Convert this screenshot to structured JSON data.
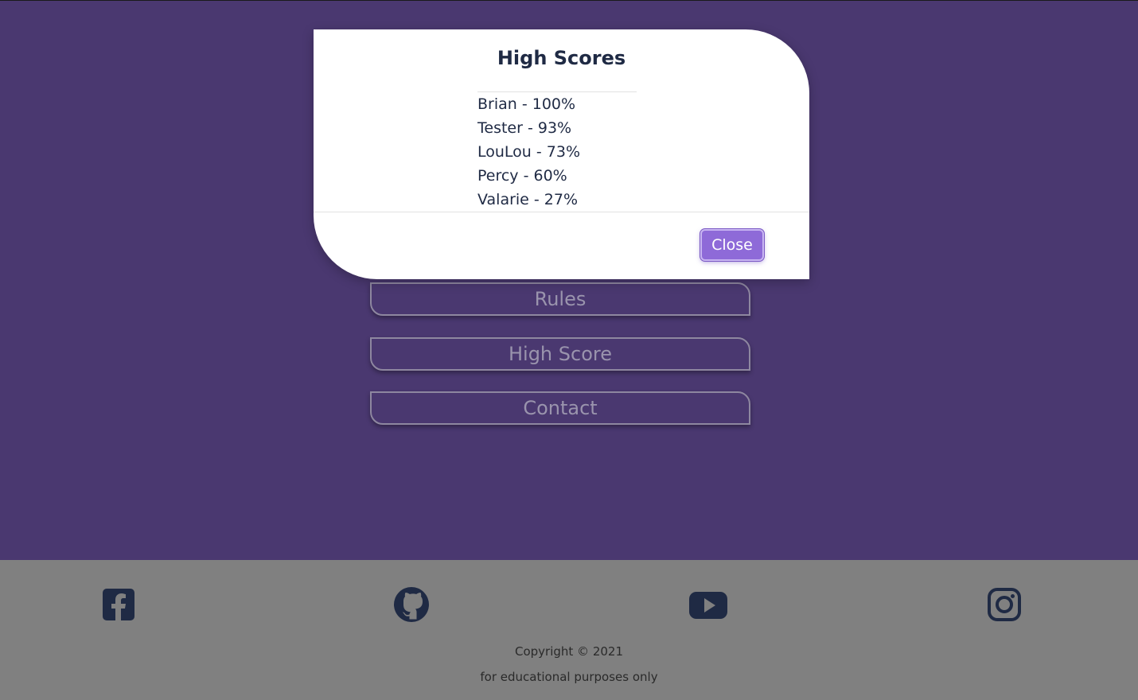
{
  "menu": {
    "items": [
      {
        "label": "Rules"
      },
      {
        "label": "High Score"
      },
      {
        "label": "Contact"
      }
    ]
  },
  "modal": {
    "title": "High Scores",
    "scores": [
      "Brian - 100%",
      "Tester - 93%",
      "LouLou - 73%",
      "Percy - 60%",
      "Valarie - 27%"
    ],
    "close_label": "Close"
  },
  "footer": {
    "social": [
      "facebook-icon",
      "github-icon",
      "youtube-icon",
      "instagram-icon"
    ],
    "copyright": "Copyright © 2021",
    "note": "for educational purposes only"
  },
  "colors": {
    "background": "#4a3870",
    "accent": "#8e6ad8",
    "footer": "#808080",
    "icon": "#1f2a44"
  }
}
